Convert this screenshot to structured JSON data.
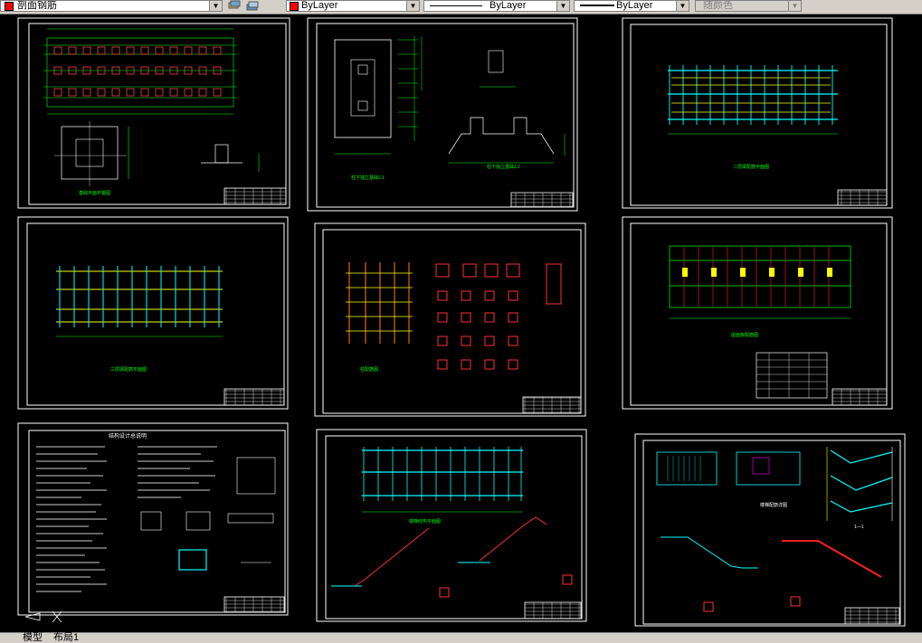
{
  "toolbar": {
    "layer_name": "剖面钢筋",
    "color_control": "ByLayer",
    "linetype_control": "ByLayer",
    "lineweight_control": "ByLayer",
    "plotstyle_control": "随颜色",
    "dropdown_glyph": "▼"
  },
  "sheets": {
    "s1_title": "基础平面布置图",
    "s2_caption_a": "柱下独立基础J-1",
    "s2_caption_b": "柱下独立基础J-2",
    "s3_title": "二层梁配筋平面图",
    "s4_title": "三层梁配筋平面图",
    "s5_title": "柱配筋图",
    "s6_title": "屋面板配筋图",
    "s7_title": "结构设计总说明",
    "s8_title": "楼梯结构平面图",
    "s9_title": "楼梯配筋详图",
    "section_1_1": "1—1"
  },
  "tabs": {
    "model": "模型",
    "layout1": "布局1"
  },
  "colors": {
    "sheet_border": "#ffffff",
    "green": "#00ff00",
    "yellow": "#ffff00",
    "cyan": "#00ffff",
    "red": "#ff0000",
    "magenta": "#ff00ff"
  }
}
